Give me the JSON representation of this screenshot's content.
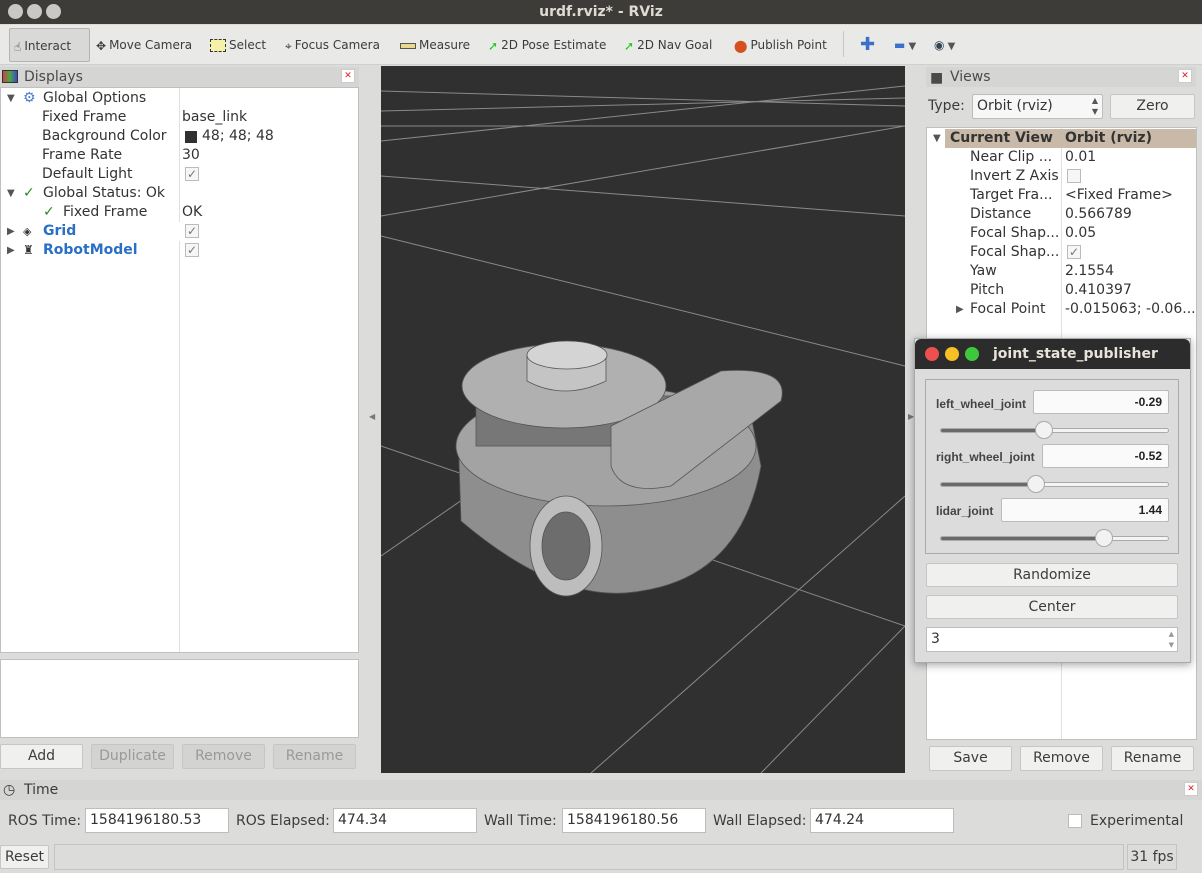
{
  "window": {
    "title": "urdf.rviz* - RViz"
  },
  "toolbar": {
    "tools": [
      "Interact",
      "Move Camera",
      "Select",
      "Focus Camera",
      "Measure",
      "2D Pose Estimate",
      "2D Nav Goal",
      "Publish Point"
    ]
  },
  "displays": {
    "title": "Displays",
    "rows": [
      {
        "label": "Global Options"
      },
      {
        "label": "Fixed Frame",
        "value": "base_link"
      },
      {
        "label": "Background Color",
        "value": "48; 48; 48",
        "color": "#303030"
      },
      {
        "label": "Frame Rate",
        "value": "30"
      },
      {
        "label": "Default Light",
        "checked": true
      },
      {
        "label": "Global Status: Ok"
      },
      {
        "label": "Fixed Frame",
        "value": "OK"
      },
      {
        "label": "Grid",
        "checked": true
      },
      {
        "label": "RobotModel",
        "checked": true
      }
    ],
    "buttons": {
      "add": "Add",
      "duplicate": "Duplicate",
      "remove": "Remove",
      "rename": "Rename"
    }
  },
  "viewport": {
    "background": "#303030"
  },
  "views": {
    "title": "Views",
    "type_label": "Type:",
    "type_value": "Orbit (rviz)",
    "zero": "Zero",
    "header": {
      "label": "Current View",
      "value": "Orbit (rviz)"
    },
    "rows": [
      {
        "label": "Near Clip ...",
        "value": "0.01"
      },
      {
        "label": "Invert Z Axis",
        "checked": false
      },
      {
        "label": "Target Fra...",
        "value": "<Fixed Frame>"
      },
      {
        "label": "Distance",
        "value": "0.566789"
      },
      {
        "label": "Focal Shap...",
        "value": "0.05"
      },
      {
        "label": "Focal Shap...",
        "checked": true
      },
      {
        "label": "Yaw",
        "value": "2.1554"
      },
      {
        "label": "Pitch",
        "value": "0.410397"
      },
      {
        "label": "Focal Point",
        "value": "-0.015063; -0.06..."
      }
    ],
    "buttons": {
      "save": "Save",
      "remove": "Remove",
      "rename": "Rename"
    }
  },
  "joint_state_publisher": {
    "title": "joint_state_publisher",
    "joints": [
      {
        "name": "left_wheel_joint",
        "value": "-0.29",
        "fraction": 0.454
      },
      {
        "name": "right_wheel_joint",
        "value": "-0.52",
        "fraction": 0.417
      },
      {
        "name": "lidar_joint",
        "value": "1.44",
        "fraction": 0.72
      }
    ],
    "randomize": "Randomize",
    "center": "Center",
    "spin_value": "3"
  },
  "time": {
    "title": "Time",
    "ros_time_label": "ROS Time:",
    "ros_time": "1584196180.53",
    "ros_elapsed_label": "ROS Elapsed:",
    "ros_elapsed": "474.34",
    "wall_time_label": "Wall Time:",
    "wall_time": "1584196180.56",
    "wall_elapsed_label": "Wall Elapsed:",
    "wall_elapsed": "474.24",
    "experimental": "Experimental"
  },
  "status": {
    "reset": "Reset",
    "fps": "31 fps"
  }
}
